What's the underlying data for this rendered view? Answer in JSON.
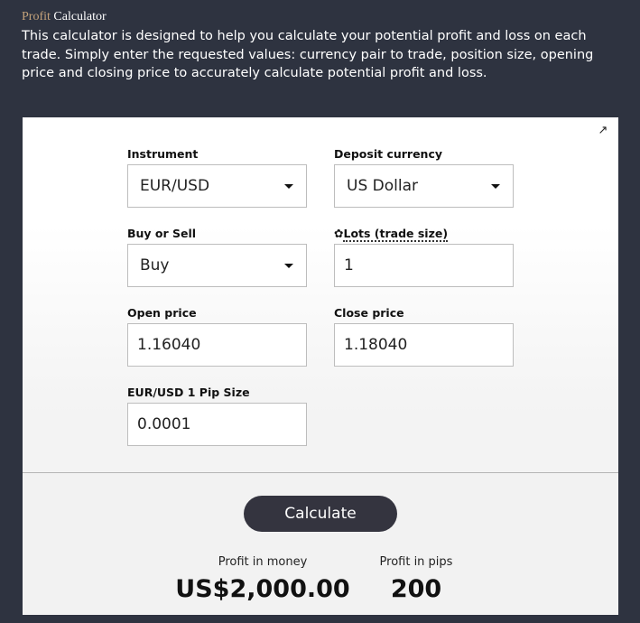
{
  "heading": {
    "word1": "Profit",
    "word2": "Calculator"
  },
  "description": "This calculator is designed to help you calculate your potential profit and loss on each trade. Simply enter the requested values: currency pair to trade, position size, opening price and closing price to accurately calculate potential profit and loss.",
  "popout_icon": "↗",
  "fields": {
    "instrument": {
      "label": "Instrument",
      "value": "EUR/USD"
    },
    "deposit_currency": {
      "label": "Deposit currency",
      "value": "US Dollar"
    },
    "buy_sell": {
      "label": "Buy or Sell",
      "value": "Buy"
    },
    "lots": {
      "icon": "✿",
      "label": "Lots (trade size)",
      "value": "1"
    },
    "open_price": {
      "label": "Open price",
      "value": "1.16040"
    },
    "close_price": {
      "label": "Close price",
      "value": "1.18040"
    },
    "pip_size": {
      "label": "EUR/USD 1 Pip Size",
      "value": "0.0001"
    }
  },
  "calculate_label": "Calculate",
  "results": {
    "money_label": "Profit in money",
    "money_value": "US$2,000.00",
    "pips_label": "Profit in pips",
    "pips_value": "200"
  }
}
